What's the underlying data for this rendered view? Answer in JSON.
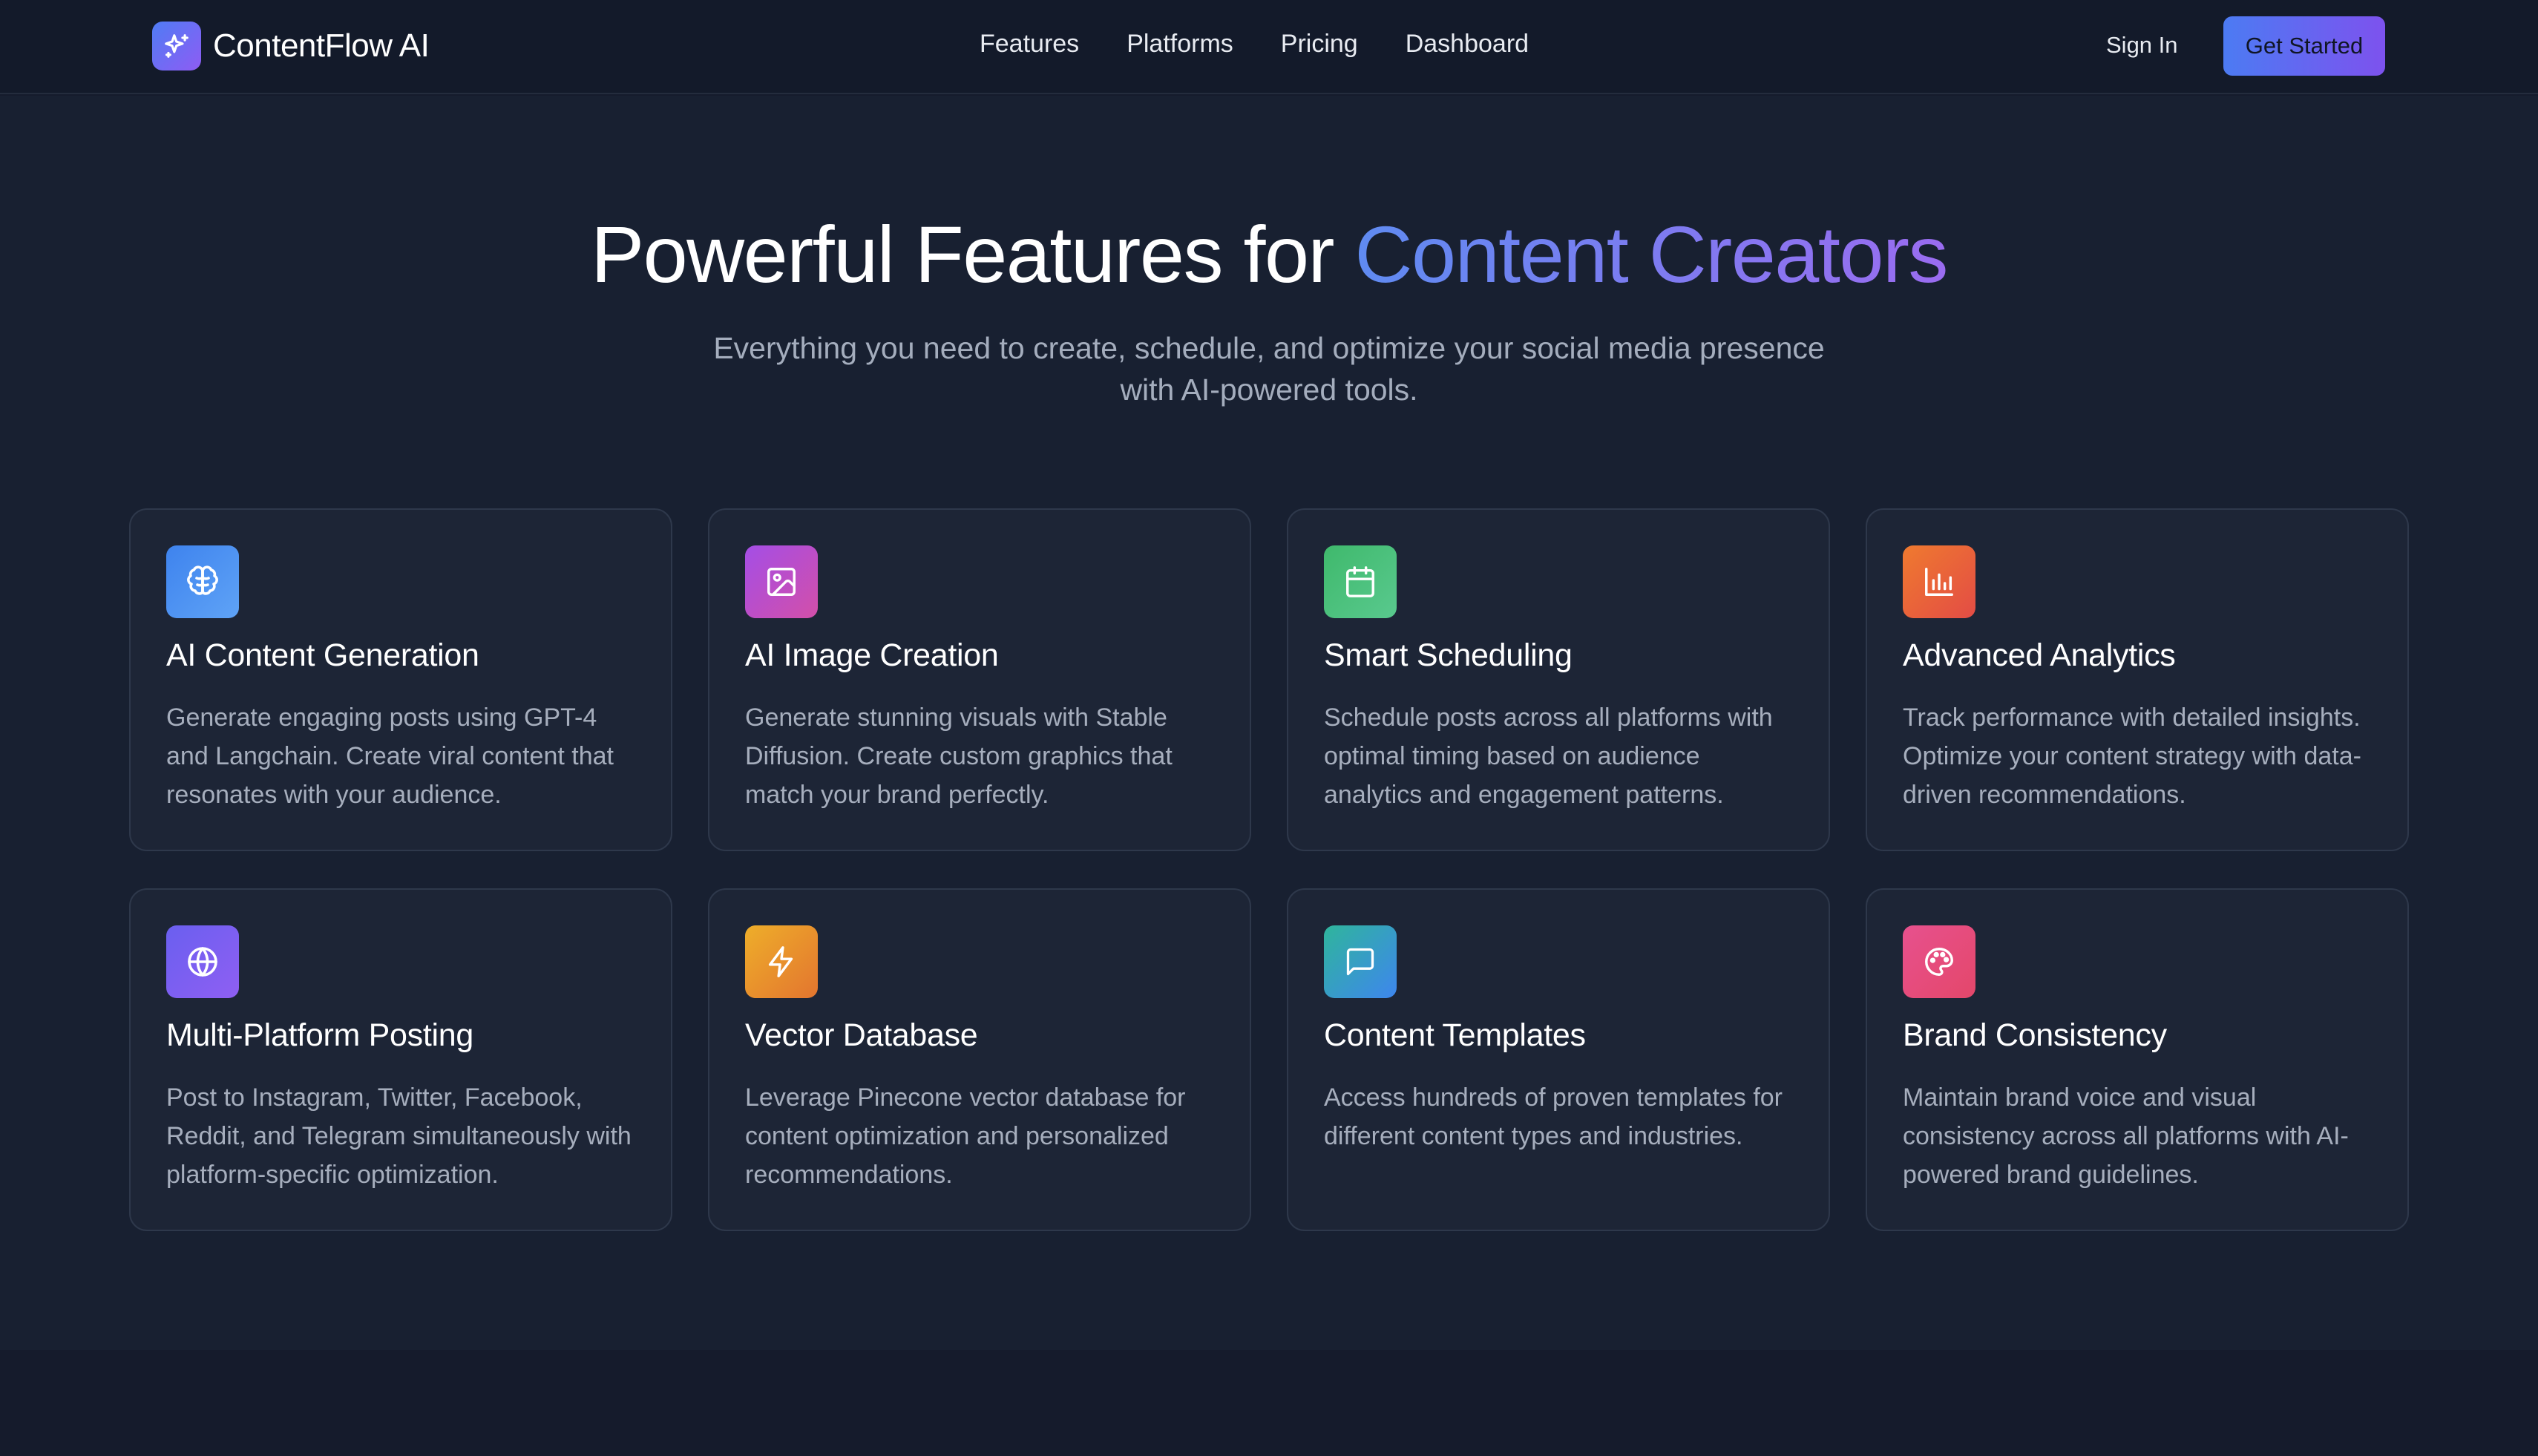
{
  "nav": {
    "brand": "ContentFlow AI",
    "links": [
      "Features",
      "Platforms",
      "Pricing",
      "Dashboard"
    ],
    "sign_in": "Sign In",
    "cta": "Get Started"
  },
  "hero": {
    "title_plain": "Powerful Features for",
    "title_accent": "Content Creators",
    "subtitle": "Everything you need to create, schedule, and optimize your social media presence with AI-powered tools."
  },
  "colors": {
    "background": "#182031",
    "card": "#1d2536",
    "accent_start": "#5f8bf1",
    "accent_end": "#9a6cf0"
  },
  "features": [
    {
      "title": "AI Content Generation",
      "description": "Generate engaging posts using GPT-4 and Langchain. Create viral content that resonates with your audience.",
      "icon": "brain-icon"
    },
    {
      "title": "AI Image Creation",
      "description": "Generate stunning visuals with Stable Diffusion. Create custom graphics that match your brand perfectly.",
      "icon": "image-icon"
    },
    {
      "title": "Smart Scheduling",
      "description": "Schedule posts across all platforms with optimal timing based on audience analytics and engagement patterns.",
      "icon": "calendar-icon"
    },
    {
      "title": "Advanced Analytics",
      "description": "Track performance with detailed insights. Optimize your content strategy with data-driven recommendations.",
      "icon": "bar-chart-icon"
    },
    {
      "title": "Multi-Platform Posting",
      "description": "Post to Instagram, Twitter, Facebook, Reddit, and Telegram simultaneously with platform-specific optimization.",
      "icon": "globe-icon"
    },
    {
      "title": "Vector Database",
      "description": "Leverage Pinecone vector database for content optimization and personalized recommendations.",
      "icon": "lightning-icon"
    },
    {
      "title": "Content Templates",
      "description": "Access hundreds of proven templates for different content types and industries.",
      "icon": "message-square-icon"
    },
    {
      "title": "Brand Consistency",
      "description": "Maintain brand voice and visual consistency across all platforms with AI-powered brand guidelines.",
      "icon": "palette-icon"
    }
  ]
}
